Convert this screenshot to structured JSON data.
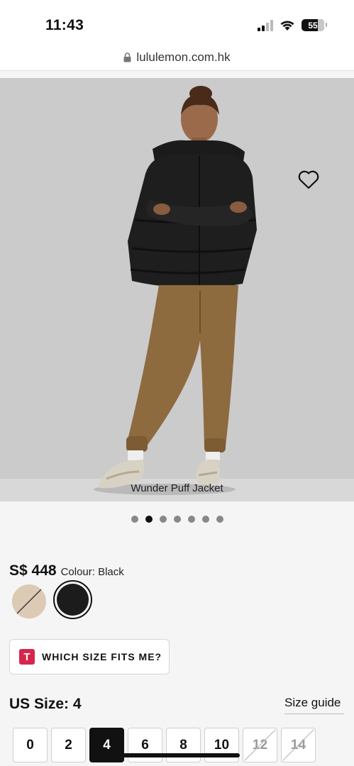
{
  "status_bar": {
    "time": "11:43",
    "battery": "55"
  },
  "browser": {
    "url": "lululemon.com.hk"
  },
  "product": {
    "name": "Wunder Puff Jacket",
    "price": "S$ 448",
    "colour_label": "Colour: Black",
    "swatches": [
      {
        "name": "Beige",
        "color": "#dccab4",
        "available": false
      },
      {
        "name": "Black",
        "color": "#1c1c1c",
        "available": true,
        "selected": true
      }
    ]
  },
  "carousel": {
    "count": 7,
    "active_index": 1
  },
  "fit_button": {
    "logo": "T",
    "label": "WHICH SIZE FITS ME?"
  },
  "size": {
    "heading": "US Size: 4",
    "guide_label": "Size guide",
    "options": [
      {
        "label": "0",
        "selected": false,
        "available": true
      },
      {
        "label": "2",
        "selected": false,
        "available": true
      },
      {
        "label": "4",
        "selected": true,
        "available": true
      },
      {
        "label": "6",
        "selected": false,
        "available": true
      },
      {
        "label": "8",
        "selected": false,
        "available": true
      },
      {
        "label": "10",
        "selected": false,
        "available": true
      },
      {
        "label": "12",
        "selected": false,
        "available": false
      },
      {
        "label": "14",
        "selected": false,
        "available": false
      }
    ]
  },
  "colors": {
    "accent": "#d6264c",
    "selected": "#111111"
  }
}
